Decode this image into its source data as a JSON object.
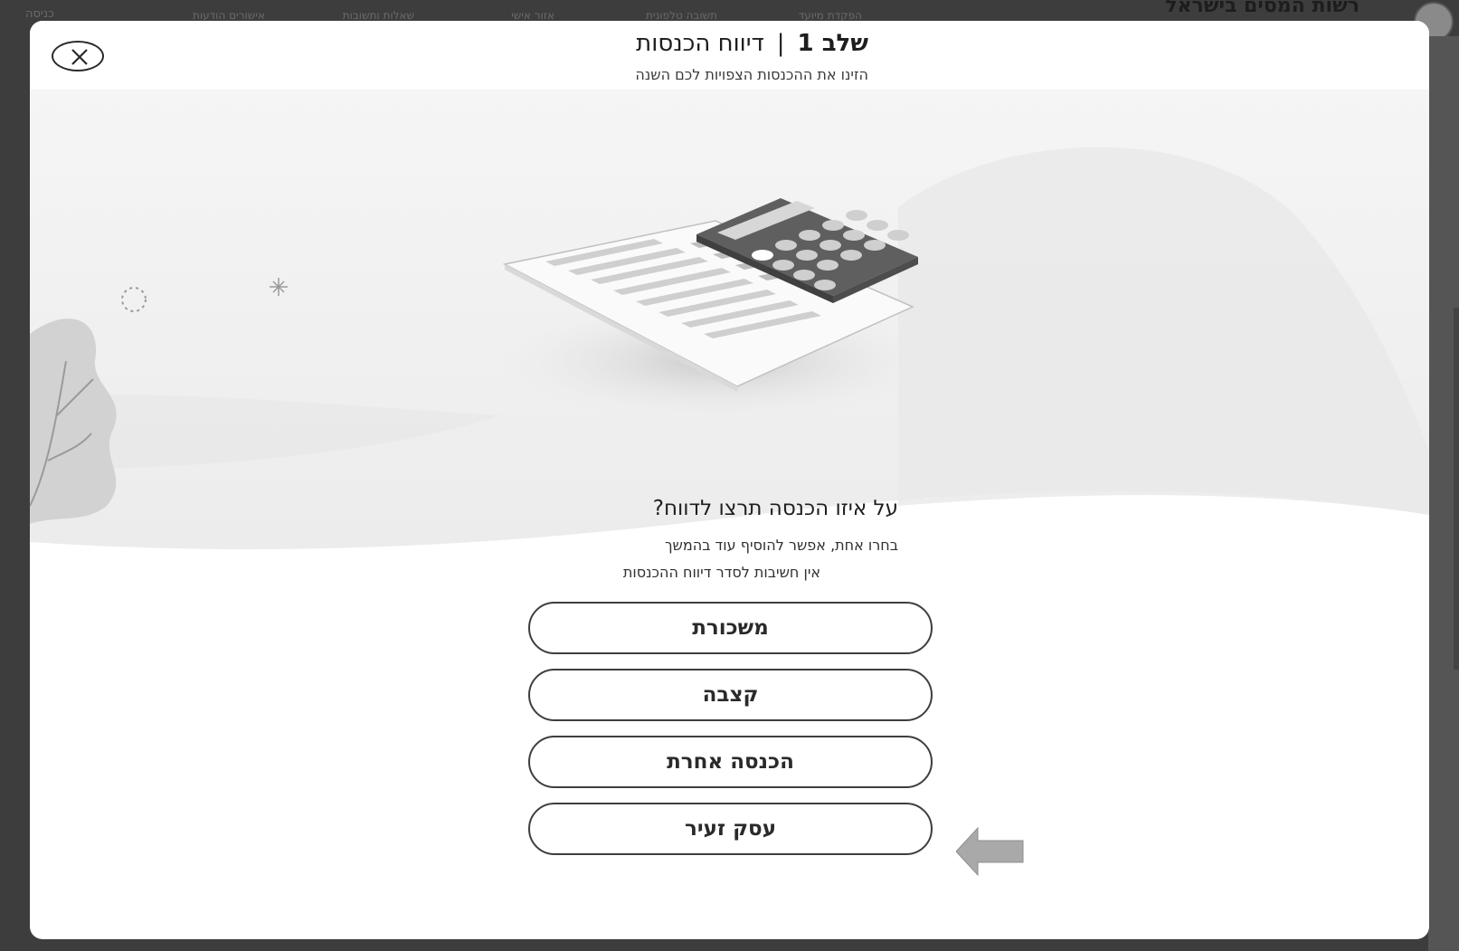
{
  "background_page": {
    "brand": "רשות המסים בישראל",
    "nav_items": [
      "הפקדת מיועד",
      "תשובה טלפונית",
      "אזור אישי",
      "שאלות ותשובות",
      "אישורים הודעות"
    ],
    "login": "כניסה"
  },
  "header": {
    "step_label": "שלב 1",
    "separator": "|",
    "title": "דיווח הכנסות",
    "subtitle": "הזינו את ההכנסות הצפויות לכם השנה"
  },
  "question": {
    "title": "על איזו הכנסה תרצו לדווח?",
    "hint_line1": "בחרו אחת, אפשר להוסיף עוד בהמשך",
    "hint_line2": "אין חשיבות לסדר דיווח ההכנסות"
  },
  "options": [
    {
      "label": "משכורת"
    },
    {
      "label": "קצבה"
    },
    {
      "label": "הכנסה אחרת"
    },
    {
      "label": "עסק זעיר"
    }
  ],
  "icons": {
    "close": "close-icon",
    "arrow": "arrow-left-icon",
    "illustration": "calculator-document-illustration"
  },
  "colors": {
    "backdrop": "#3d3d3d",
    "modal": "#ffffff",
    "wave": "#eeeeee",
    "button_border": "#3e3e3e"
  }
}
